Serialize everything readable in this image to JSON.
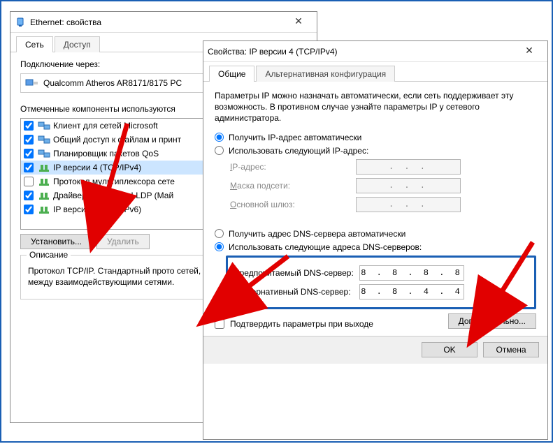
{
  "window1": {
    "title": "Ethernet: свойства",
    "tabs": {
      "network": "Сеть",
      "access": "Доступ"
    },
    "connect_via": "Подключение через:",
    "adapter": "Qualcomm Atheros AR8171/8175 PC",
    "components_label": "Отмеченные компоненты используются",
    "items": [
      {
        "checked": true,
        "label": "Клиент для сетей Microsoft"
      },
      {
        "checked": true,
        "label": "Общий доступ к файлам и принт"
      },
      {
        "checked": true,
        "label": "Планировщик пакетов QoS"
      },
      {
        "checked": true,
        "label": "IP версии 4 (TCP/IPv4)",
        "selected": true
      },
      {
        "checked": false,
        "label": "Протокол мультиплексора сете"
      },
      {
        "checked": true,
        "label": "Драйвер протокола LLDP (Май"
      },
      {
        "checked": true,
        "label": "IP версии 6 (TCP/IPv6)"
      }
    ],
    "buttons": {
      "install": "Установить...",
      "remove": "Удалить"
    },
    "desc_title": "Описание",
    "desc_text": "Протокол TCP/IP. Стандартный прото сетей, обеспечивающий связь между взаимодействующими сетями."
  },
  "window2": {
    "title": "Свойства: IP версии 4 (TCP/IPv4)",
    "tabs": {
      "general": "Общие",
      "alt": "Альтернативная конфигурация"
    },
    "info": "Параметры IP можно назначать автоматически, если сеть поддерживает эту возможность. В противном случае узнайте параметры IP у сетевого администратора.",
    "radio_ip_auto": "Получить IP-адрес автоматически",
    "radio_ip_manual": "Использовать следующий IP-адрес:",
    "fields": {
      "ip": "IP-адрес:",
      "mask": "Маска подсети:",
      "gw": "Основной шлюз:"
    },
    "radio_dns_auto": "Получить адрес DNS-сервера автоматически",
    "radio_dns_manual": "Использовать следующие адреса DNS-серверов:",
    "dns_pref_label": "Предпочитаемый DNS-сервер:",
    "dns_alt_label": "Альтернативный DNS-сервер:",
    "dns_pref_value": "8 . 8 . 8 . 8",
    "dns_alt_value": "8 . 8 . 4 . 4",
    "validate_label": "Подтвердить параметры при выходе",
    "advanced": "Дополнительно...",
    "ok": "OK",
    "cancel": "Отмена"
  },
  "dots": ".   .   ."
}
